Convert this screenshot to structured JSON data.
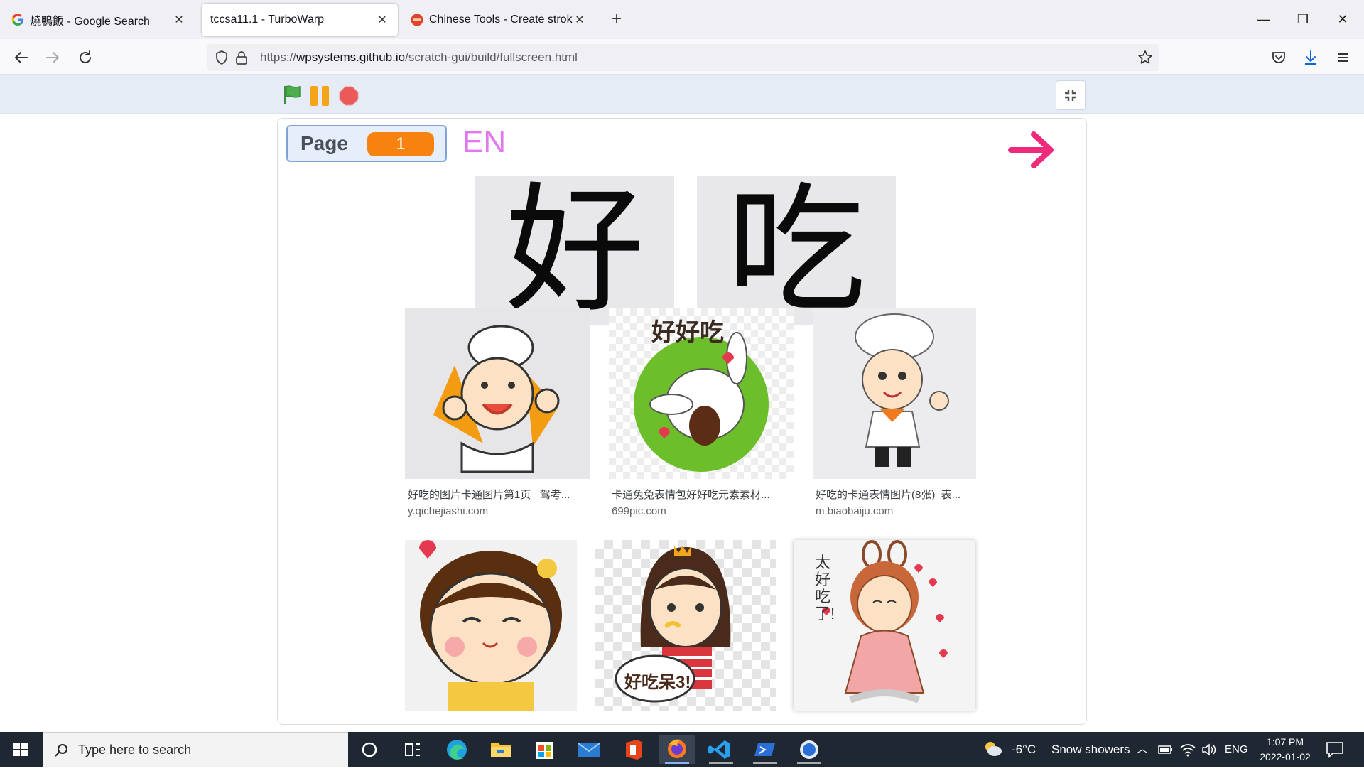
{
  "browser": {
    "tabs": [
      {
        "title": "燒鴨飯 - Google Search",
        "favicon": "google-g-icon"
      },
      {
        "title": "tccsa11.1 - TurboWarp",
        "favicon": "none"
      },
      {
        "title": "Chinese Tools - Create stroke or",
        "favicon": "chinese-tools-icon"
      }
    ],
    "url_prefix": "https://",
    "url_host": "wpsystems.github.io",
    "url_path": "/scratch-gui/build/fullscreen.html"
  },
  "stage": {
    "page_label": "Page",
    "page_number": "1",
    "lang_toggle": "EN",
    "characters": [
      "好",
      "吃"
    ],
    "results_row1": [
      {
        "caption": "好吃的图片卡通图片第1页_ 驾考...",
        "source": "y.qichejiashi.com"
      },
      {
        "caption": "卡通兔兔表情包好好吃元素素材...",
        "source": "699pic.com"
      },
      {
        "caption": "好吃的卡通表情图片(8张)_表...",
        "source": "m.biaobaiju.com"
      }
    ],
    "image_texts": {
      "bunny_banner": "好好吃",
      "speech_bubble": "好吃呆3!",
      "vertical_text": "太好吃了!"
    }
  },
  "taskbar": {
    "search_placeholder": "Type here to search",
    "weather_temp": "-6°C",
    "weather_desc": "Snow showers",
    "language": "ENG",
    "time": "1:07 PM",
    "date": "2022-01-02"
  },
  "colors": {
    "accent_orange": "#f7820f",
    "lang_pink": "#e277f0",
    "arrow_pink": "#ee2a7b",
    "flag_green": "#4cae4c"
  }
}
